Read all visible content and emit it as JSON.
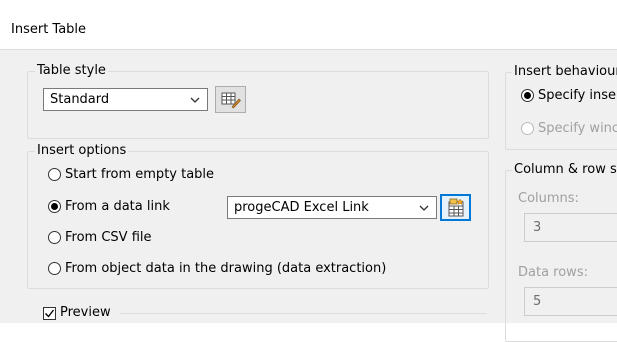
{
  "window": {
    "title": "Insert Table"
  },
  "table_style": {
    "group_label": "Table style",
    "selected": "Standard",
    "launch_button_icon": "table-style-dialog-icon"
  },
  "insert_options": {
    "group_label": "Insert options",
    "options": [
      {
        "label": "Start from empty table",
        "checked": false
      },
      {
        "label": "From a data link",
        "checked": true
      },
      {
        "label": "From CSV file",
        "checked": false
      },
      {
        "label": "From object data in the drawing (data extraction)",
        "checked": false
      }
    ],
    "data_link_selected": "progeCAD Excel Link",
    "data_link_button_icon": "data-link-manager-icon"
  },
  "preview": {
    "label": "Preview",
    "checked": true
  },
  "insert_behaviour": {
    "group_label": "Insert behaviour",
    "options": [
      {
        "label": "Specify inse",
        "checked": true,
        "enabled": true
      },
      {
        "label": "Specify winc",
        "checked": false,
        "enabled": false
      }
    ]
  },
  "column_row_settings": {
    "group_label": "Column & row se",
    "columns_label": "Columns:",
    "columns_value": "3",
    "data_rows_label": "Data rows:",
    "data_rows_value": "5"
  },
  "colors": {
    "accent": "#0078d7",
    "disabled_text": "#a0a0a0",
    "dialog_bg": "#f0f0f0"
  }
}
